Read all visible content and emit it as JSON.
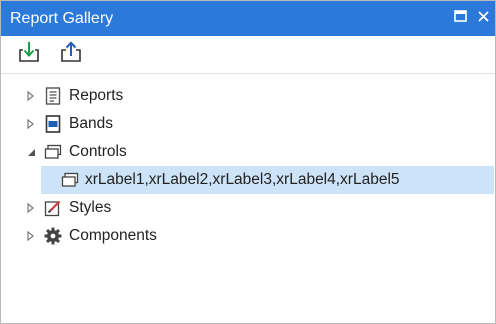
{
  "window": {
    "title": "Report Gallery",
    "buttons": [
      {
        "name": "maximize-icon"
      },
      {
        "name": "close-icon"
      }
    ]
  },
  "toolbar": {
    "buttons": [
      {
        "name": "import-icon"
      },
      {
        "name": "export-icon"
      }
    ]
  },
  "tree": {
    "items": [
      {
        "label": "Reports",
        "icon": "report-icon",
        "state": "collapsed"
      },
      {
        "label": "Bands",
        "icon": "band-icon",
        "state": "collapsed"
      },
      {
        "label": "Controls",
        "icon": "controls-icon",
        "state": "expanded"
      },
      {
        "label": "xrLabel1,xrLabel2,xrLabel3,xrLabel4,xrLabel5",
        "icon": "controls-icon",
        "state": "leaf",
        "selected": true
      },
      {
        "label": "Styles",
        "icon": "styles-icon",
        "state": "collapsed"
      },
      {
        "label": "Components",
        "icon": "gear-icon",
        "state": "collapsed"
      }
    ]
  },
  "colors": {
    "titlebar": "#2b79d8",
    "selection": "#cde3f7",
    "icon_green": "#1e9e4a",
    "icon_blue": "#1f5fb4"
  }
}
